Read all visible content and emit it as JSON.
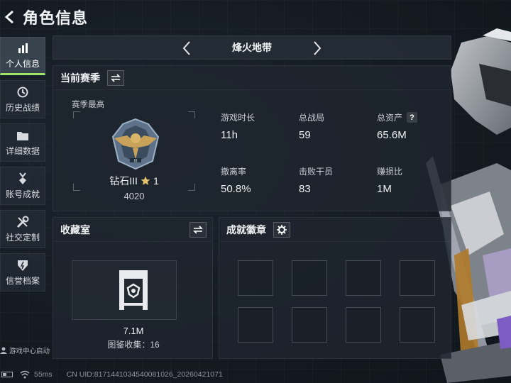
{
  "header": {
    "title": "角色信息"
  },
  "sidebar": {
    "items": [
      {
        "label": "个人信息",
        "icon": "bar-chart-icon",
        "active": true
      },
      {
        "label": "历史战绩",
        "icon": "history-icon",
        "active": false
      },
      {
        "label": "详细数据",
        "icon": "folder-icon",
        "active": false
      },
      {
        "label": "账号成就",
        "icon": "medal-icon",
        "active": false
      },
      {
        "label": "社交定制",
        "icon": "tools-icon",
        "active": false
      },
      {
        "label": "信誉档案",
        "icon": "shield-icon",
        "active": false
      }
    ],
    "launch_hint": "游戏中心启动"
  },
  "map_selector": {
    "name": "烽火地带"
  },
  "season": {
    "title": "当前赛季",
    "subtitle": "赛季最高",
    "rank_name": "钻石III",
    "rank_stars": "1",
    "rank_score": "4020",
    "stats": [
      {
        "key": "游戏时长",
        "value": "11h"
      },
      {
        "key": "总战局",
        "value": "59"
      },
      {
        "key": "总资产",
        "value": "65.6M",
        "help": "?"
      },
      {
        "key": "撤离率",
        "value": "50.8%"
      },
      {
        "key": "击败干员",
        "value": "83"
      },
      {
        "key": "赚损比",
        "value": "1M"
      }
    ]
  },
  "collection": {
    "title": "收藏室",
    "value": "7.1M",
    "count_text": "图鉴收集：16"
  },
  "achievements": {
    "title": "成就徽章"
  },
  "footer": {
    "ping": "55ms",
    "uid": "CN UID:8171441034540081026_20260421071"
  },
  "colors": {
    "accent": "#9fe36a",
    "panel": "#1e262e",
    "background": "#141b22"
  }
}
